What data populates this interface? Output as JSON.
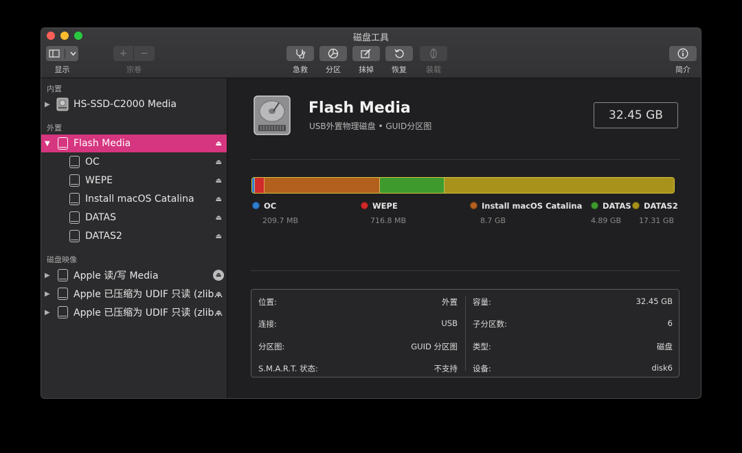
{
  "window": {
    "title": "磁盘工具"
  },
  "toolbar": {
    "view_label": "显示",
    "volume_label": "宗卷",
    "firstaid_label": "急救",
    "partition_label": "分区",
    "erase_label": "抹掉",
    "restore_label": "恢复",
    "mount_label": "装载",
    "info_label": "简介",
    "add_glyph": "+",
    "remove_glyph": "−"
  },
  "sidebar": {
    "internal_header": "内置",
    "external_header": "外置",
    "images_header": "磁盘映像",
    "internal": [
      {
        "label": "HS-SSD-C2000 Media"
      }
    ],
    "external_disk": {
      "label": "Flash Media"
    },
    "volumes": [
      {
        "label": "OC"
      },
      {
        "label": "WEPE"
      },
      {
        "label": "Install macOS Catalina"
      },
      {
        "label": "DATAS"
      },
      {
        "label": "DATAS2"
      }
    ],
    "images": [
      {
        "label": "Apple 读/写 Media"
      },
      {
        "label": "Apple 已压缩为 UDIF 只读 (zlib..."
      },
      {
        "label": "Apple 已压缩为 UDIF 只读 (zlib..."
      }
    ]
  },
  "main": {
    "disk_title": "Flash Media",
    "disk_subtitle": "USB外置物理磁盘 • GUID分区图",
    "capacity": "32.45 GB",
    "partitions": [
      {
        "name": "OC",
        "size": "209.7 MB",
        "gb": 0.21,
        "color": "#2f7fd0"
      },
      {
        "name": "WEPE",
        "size": "716.8 MB",
        "gb": 0.72,
        "color": "#d02a2a"
      },
      {
        "name": "Install macOS Catalina",
        "size": "8.7 GB",
        "gb": 8.7,
        "color": "#b3601f"
      },
      {
        "name": "DATAS",
        "size": "4.89 GB",
        "gb": 4.89,
        "color": "#3f9a2e"
      },
      {
        "name": "DATAS2",
        "size": "17.31 GB",
        "gb": 17.31,
        "color": "#a8921c"
      }
    ],
    "info_left": [
      {
        "key": "位置:",
        "value": "外置"
      },
      {
        "key": "连接:",
        "value": "USB"
      },
      {
        "key": "分区图:",
        "value": "GUID 分区图"
      },
      {
        "key": "S.M.A.R.T. 状态:",
        "value": "不支持"
      }
    ],
    "info_right": [
      {
        "key": "容量:",
        "value": "32.45 GB"
      },
      {
        "key": "子分区数:",
        "value": "6"
      },
      {
        "key": "类型:",
        "value": "磁盘"
      },
      {
        "key": "设备:",
        "value": "disk6"
      }
    ]
  }
}
